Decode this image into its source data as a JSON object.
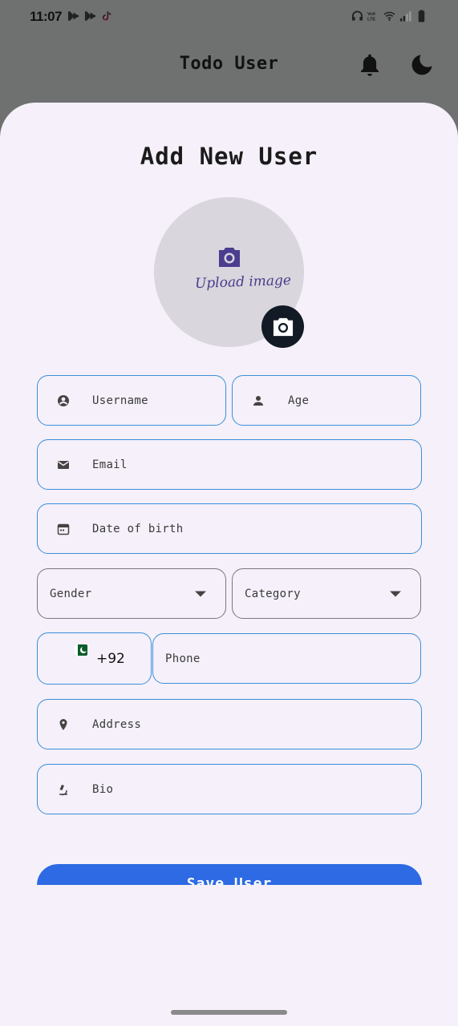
{
  "status_bar": {
    "time": "11:07",
    "left_icons": [
      "bluesky-icon",
      "bluesky-icon",
      "tiktok-icon"
    ],
    "right_icons": [
      "headphones-icon",
      "volte-icon",
      "wifi-icon",
      "signal-icon",
      "battery-icon"
    ]
  },
  "app_bar": {
    "title": "Todo User",
    "actions": [
      "bell-icon",
      "moon-icon"
    ]
  },
  "form": {
    "title": "Add New User",
    "avatar": {
      "label": "Upload image",
      "icon": "camera-icon",
      "fab_icon": "camera-icon"
    },
    "fields": {
      "username": {
        "label": "Username",
        "icon": "account-circle-icon"
      },
      "age": {
        "label": "Age",
        "icon": "person-icon"
      },
      "email": {
        "label": "Email",
        "icon": "mail-icon"
      },
      "dob": {
        "label": "Date of birth",
        "icon": "calendar-icon"
      },
      "gender": {
        "label": "Gender",
        "icon": "dropdown-arrow-icon"
      },
      "category": {
        "label": "Category",
        "icon": "dropdown-arrow-icon"
      },
      "country_code": {
        "value": "+92",
        "icon": "pakistan-flag-icon"
      },
      "phone": {
        "label": "Phone"
      },
      "address": {
        "label": "Address",
        "icon": "location-pin-icon"
      },
      "bio": {
        "label": "Bio",
        "icon": "microscope-icon"
      }
    },
    "save_button": "Save User"
  },
  "colors": {
    "sheet_bg": "#f5f0f9",
    "scrim": "#6f7171",
    "field_border": "#3a8fd8",
    "dropdown_border": "#7a7780",
    "primary_button": "#2d6ae3",
    "fab_bg": "#111a25",
    "accent_icon": "#4a3b8c"
  }
}
